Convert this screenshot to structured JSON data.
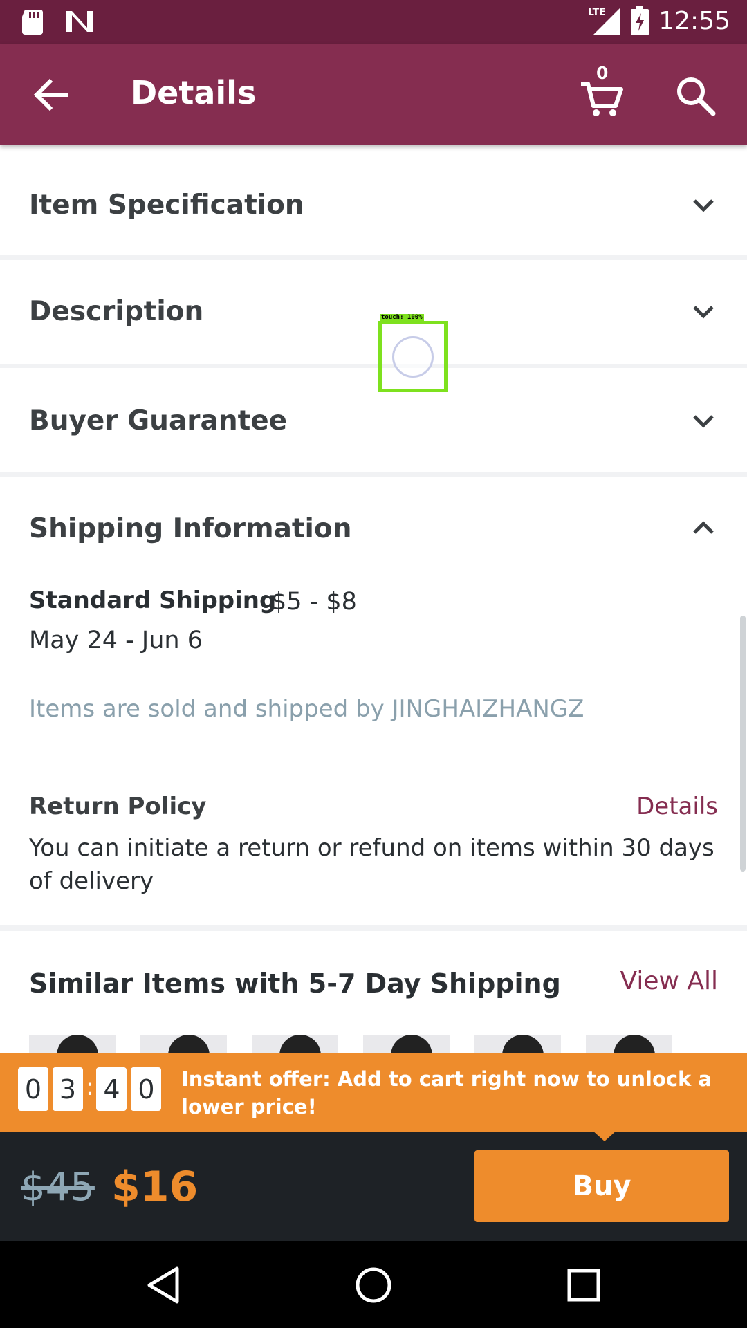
{
  "status_bar": {
    "time": "12:55",
    "network": "LTE"
  },
  "app_bar": {
    "title": "Details",
    "cart_count": "0"
  },
  "sections": {
    "item_specification": "Item Specification",
    "description": "Description",
    "buyer_guarantee": "Buyer Guarantee",
    "shipping_information": "Shipping Information"
  },
  "shipping": {
    "standard_label": "Standard Shipping",
    "standard_price": "$5 - $8",
    "dates": "May 24 - Jun 6",
    "seller_note": "Items are sold and shipped by JINGHAIZHANGZ"
  },
  "return_policy": {
    "label": "Return Policy",
    "details_link": "Details",
    "text": "You can initiate a return or refund on items within 30 days of delivery"
  },
  "similar": {
    "title": "Similar Items with 5-7 Day Shipping",
    "view_all": "View All"
  },
  "touch_overlay": {
    "label": "touch: 100%"
  },
  "offer": {
    "timer": [
      "0",
      "3",
      "4",
      "0"
    ],
    "separator": ":",
    "text": "Instant offer: Add to cart right now to unlock a lower price!"
  },
  "buy_bar": {
    "old_price": "$45",
    "new_price": "$16",
    "buy_label": "Buy"
  },
  "colors": {
    "status_bar": "#6a1f3f",
    "app_bar": "#852d50",
    "accent_orange": "#ee8c2c",
    "buy_bar": "#1e2226"
  }
}
